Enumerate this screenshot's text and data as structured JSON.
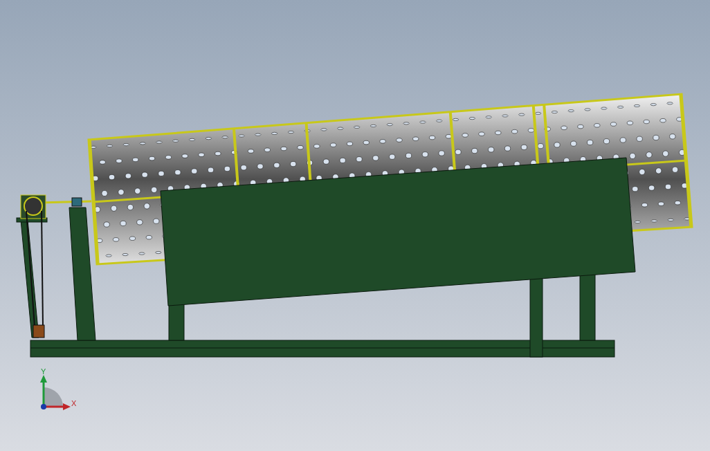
{
  "viewport": {
    "triad": {
      "axes": [
        {
          "label": "Y",
          "kind": "vertical",
          "color": "#1f9a3a"
        },
        {
          "label": "X",
          "kind": "horizontal",
          "color": "#c0262a"
        }
      ]
    }
  }
}
